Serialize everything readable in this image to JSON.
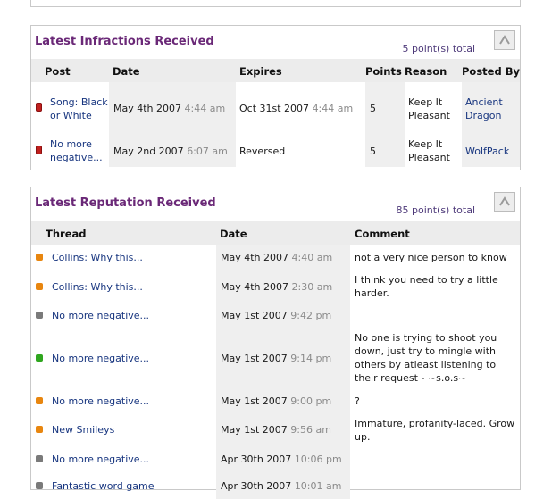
{
  "infractions": {
    "title": "Latest Infractions Received",
    "total": "5 point(s) total",
    "headers": {
      "post": "Post",
      "date": "Date",
      "expires": "Expires",
      "points": "Points",
      "reason": "Reason",
      "posted_by": "Posted By"
    },
    "rows": [
      {
        "post": "Song: Black or White",
        "date": "May 4th 2007",
        "time": "4:44 am",
        "expires": "Oct 31st 2007",
        "expires_time": "4:44 am",
        "points": "5",
        "reason": "Keep It Pleasant",
        "posted_by": "Ancient Dragon"
      },
      {
        "post": "No more negative...",
        "date": "May 2nd 2007",
        "time": "6:07 am",
        "expires": "Reversed",
        "expires_time": "",
        "points": "5",
        "reason": "Keep It Pleasant",
        "posted_by": "WolfPack"
      }
    ]
  },
  "reputation": {
    "title": "Latest Reputation Received",
    "total": "85 point(s) total",
    "headers": {
      "thread": "Thread",
      "date": "Date",
      "comment": "Comment"
    },
    "rows": [
      {
        "color": "#e8860f",
        "thread": "Collins: Why this...",
        "date": "May 4th 2007",
        "time": "4:40 am",
        "comment": "not a very nice person to know"
      },
      {
        "color": "#e8860f",
        "thread": "Collins: Why this...",
        "date": "May 4th 2007",
        "time": "2:30 am",
        "comment": "I think you need to try a little harder."
      },
      {
        "color": "#7a7a7a",
        "thread": "No more negative...",
        "date": "May 1st 2007",
        "time": "9:42 pm",
        "comment": ""
      },
      {
        "color": "#2fa61f",
        "thread": "No more negative...",
        "date": "May 1st 2007",
        "time": "9:14 pm",
        "comment": "No one is trying to shoot you down, just try to mingle with others by atleast listening to their request - ~s.o.s~"
      },
      {
        "color": "#e8860f",
        "thread": "No more negative...",
        "date": "May 1st 2007",
        "time": "9:00 pm",
        "comment": "?"
      },
      {
        "color": "#e8860f",
        "thread": "New Smileys",
        "date": "May 1st 2007",
        "time": "9:56 am",
        "comment": "Immature, profanity-laced. Grow up."
      },
      {
        "color": "#7a7a7a",
        "thread": "No more negative...",
        "date": "Apr 30th 2007",
        "time": "10:06 pm",
        "comment": ""
      },
      {
        "color": "#7a7a7a",
        "thread": "Fantastic word game",
        "date": "Apr 30th 2007",
        "time": "10:01 am",
        "comment": ""
      }
    ]
  }
}
